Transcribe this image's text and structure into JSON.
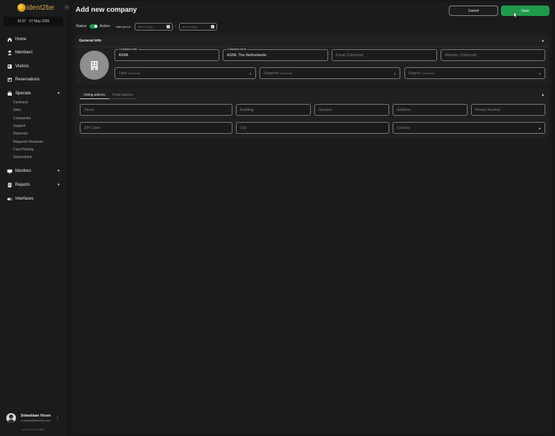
{
  "sidebar": {
    "logo_text": "ident2be",
    "clock": {
      "time": "10:07",
      "date": "07 May 2026"
    },
    "nav": [
      {
        "label": "Home",
        "icon": "home-icon"
      },
      {
        "label": "Members",
        "icon": "person-icon"
      },
      {
        "label": "Visitors",
        "icon": "id-card-icon"
      },
      {
        "label": "Reservations",
        "icon": "calendar-icon"
      },
      {
        "label": "Specials",
        "icon": "briefcase-icon"
      },
      {
        "label": "Monitors",
        "icon": "monitor-icon"
      },
      {
        "label": "Reports",
        "icon": "report-icon"
      },
      {
        "label": "Interfaces",
        "icon": "toggle-icon"
      }
    ],
    "specials_sub": [
      "Contracts",
      "Sites",
      "Companies",
      "Support",
      "Requests",
      "Requests Reviewer",
      "Card Printing",
      "Subscription"
    ],
    "user": {
      "name": "Sebastiaan Viezee",
      "email": "s.viezee@ident2be.com"
    },
    "version": "v0.29.x-rc.0.5898"
  },
  "header": {
    "title": "Add new company",
    "cancel_label": "Cancel",
    "save_label": "Save"
  },
  "status": {
    "label": "Status",
    "value": "Active",
    "active": true,
    "valid_period_label": "Valid period:",
    "date_placeholder": "dd.mm.yyyy",
    "separator": "-"
  },
  "general_info": {
    "title": "General info",
    "company_code": {
      "label": "Company code",
      "value": "ASML"
    },
    "company_name": {
      "label": "Company name",
      "value": "ASML The Netherlands"
    },
    "email": {
      "placeholder": "Email",
      "optional": "(Optional)"
    },
    "website": {
      "placeholder": "Website",
      "optional": "(Optional)"
    },
    "type": {
      "placeholder": "Type",
      "optional": "(Optional)"
    },
    "segment": {
      "placeholder": "Segment",
      "optional": "(Optional)"
    },
    "region": {
      "placeholder": "Region",
      "optional": "(Optional)"
    }
  },
  "address": {
    "tabs": [
      "Visiting address",
      "Postal address"
    ],
    "street": "Street",
    "building": "Building",
    "number": "Number",
    "addition": "Addition",
    "phone": "Phone Number",
    "zip": "ZIP Code",
    "city": "City",
    "country": "Country"
  },
  "colors": {
    "accent": "#1f9a4b",
    "background": "#151617",
    "panel": "#1f2021"
  }
}
